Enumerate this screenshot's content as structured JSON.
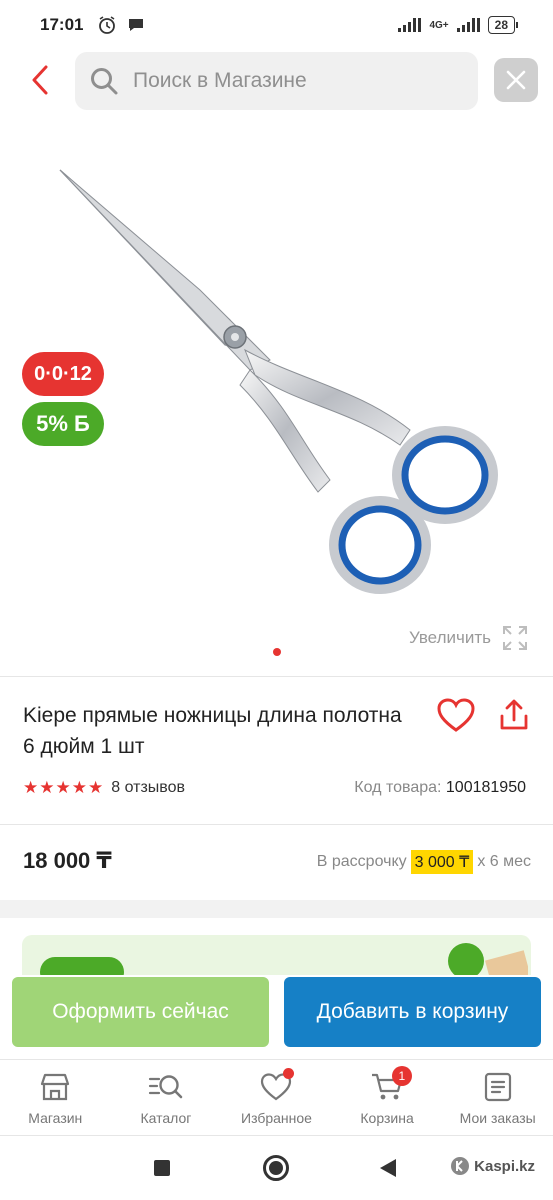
{
  "status_bar": {
    "time": "17:01",
    "network": "4G+",
    "battery": "28"
  },
  "header": {
    "search_placeholder": "Поиск в Магазине"
  },
  "product": {
    "badge_installment": "0·0·12",
    "badge_bonus": "5% Б",
    "zoom_label": "Увеличить",
    "title": "Kiepe прямые ножницы длина полотна 6 дюйм 1 шт",
    "rating_stars": 5,
    "reviews": "8 отзывов",
    "code_label": "Код товара:",
    "code_value": "100181950",
    "price": "18 000 ₸",
    "installment_prefix": "В рассрочку",
    "installment_amount": "3 000 ₸",
    "installment_suffix": "x 6 мес"
  },
  "actions": {
    "buy_now": "Оформить сейчас",
    "add_to_cart": "Добавить в корзину"
  },
  "nav": {
    "items": [
      {
        "label": "Магазин",
        "icon": "shop-icon"
      },
      {
        "label": "Каталог",
        "icon": "catalog-search-icon"
      },
      {
        "label": "Избранное",
        "icon": "heart-icon"
      },
      {
        "label": "Корзина",
        "icon": "cart-icon",
        "count": "1"
      },
      {
        "label": "Мои заказы",
        "icon": "orders-icon"
      }
    ]
  },
  "watermark": "Kaspi.kz",
  "colors": {
    "accent_red": "#e63431",
    "green": "#4caa28",
    "blue": "#1680c6",
    "highlight_yellow": "#ffd600"
  }
}
